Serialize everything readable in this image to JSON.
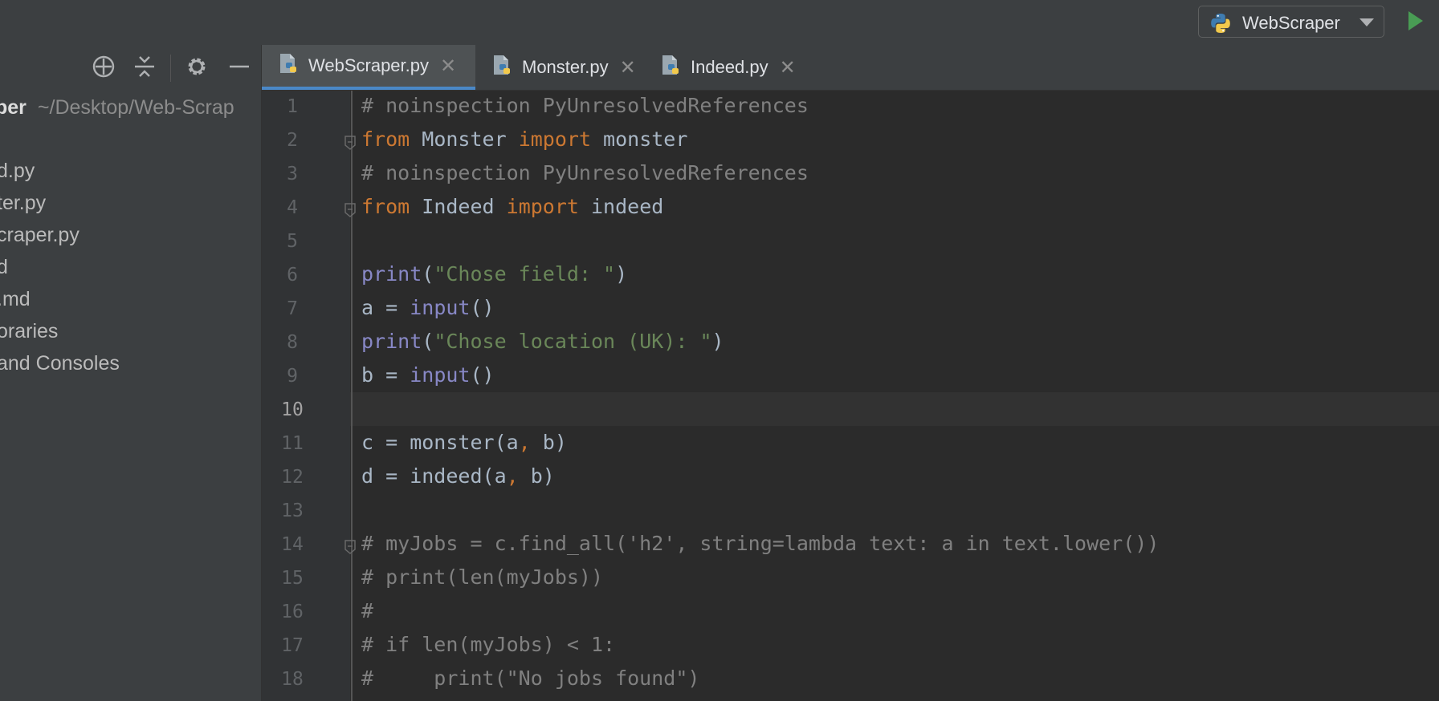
{
  "toolbar": {
    "run_config_label": "WebScraper",
    "icons": [
      "python-icon",
      "dropdown-arrow-icon",
      "run-icon"
    ],
    "run_color": "#499c54"
  },
  "sidebar": {
    "toolbar_icons": [
      "locate-icon",
      "collapse-all-icon",
      "gear-icon",
      "hide-icon"
    ],
    "root_name": "per",
    "root_path": "~/Desktop/Web-Scrap",
    "items": [
      {
        "label": "d.py"
      },
      {
        "label": "ter.py"
      },
      {
        "label": "craper.py"
      },
      {
        "label": "d"
      },
      {
        "label": ".md"
      },
      {
        "label": "oraries"
      },
      {
        "label": "and Consoles"
      }
    ]
  },
  "tabs": [
    {
      "label": "WebScraper.py",
      "active": true
    },
    {
      "label": "Monster.py",
      "active": false
    },
    {
      "label": "Indeed.py",
      "active": false
    }
  ],
  "editor": {
    "current_line": 10,
    "lines": [
      {
        "n": "1",
        "tokens": [
          {
            "t": "# noinspection PyUnresolvedReferences",
            "c": "cm"
          }
        ]
      },
      {
        "n": "2",
        "tokens": [
          {
            "t": "from",
            "c": "kw"
          },
          {
            "t": " Monster ",
            "c": "id"
          },
          {
            "t": "import",
            "c": "kw"
          },
          {
            "t": " monster",
            "c": "id"
          }
        ]
      },
      {
        "n": "3",
        "tokens": [
          {
            "t": "# noinspection PyUnresolvedReferences",
            "c": "cm"
          }
        ]
      },
      {
        "n": "4",
        "tokens": [
          {
            "t": "from",
            "c": "kw"
          },
          {
            "t": " Indeed ",
            "c": "id"
          },
          {
            "t": "import",
            "c": "kw"
          },
          {
            "t": " indeed",
            "c": "id"
          }
        ]
      },
      {
        "n": "5",
        "tokens": []
      },
      {
        "n": "6",
        "tokens": [
          {
            "t": "print",
            "c": "bi"
          },
          {
            "t": "(",
            "c": "id"
          },
          {
            "t": "\"Chose field: \"",
            "c": "st"
          },
          {
            "t": ")",
            "c": "id"
          }
        ]
      },
      {
        "n": "7",
        "tokens": [
          {
            "t": "a = ",
            "c": "id"
          },
          {
            "t": "input",
            "c": "bi"
          },
          {
            "t": "()",
            "c": "id"
          }
        ]
      },
      {
        "n": "8",
        "tokens": [
          {
            "t": "print",
            "c": "bi"
          },
          {
            "t": "(",
            "c": "id"
          },
          {
            "t": "\"Chose location (UK): \"",
            "c": "st"
          },
          {
            "t": ")",
            "c": "id"
          }
        ]
      },
      {
        "n": "9",
        "tokens": [
          {
            "t": "b = ",
            "c": "id"
          },
          {
            "t": "input",
            "c": "bi"
          },
          {
            "t": "()",
            "c": "id"
          }
        ]
      },
      {
        "n": "10",
        "tokens": []
      },
      {
        "n": "11",
        "tokens": [
          {
            "t": "c = monster(a",
            "c": "id"
          },
          {
            "t": ",",
            "c": "kw"
          },
          {
            "t": " b)",
            "c": "id"
          }
        ]
      },
      {
        "n": "12",
        "tokens": [
          {
            "t": "d = indeed(a",
            "c": "id"
          },
          {
            "t": ",",
            "c": "kw"
          },
          {
            "t": " b)",
            "c": "id"
          }
        ]
      },
      {
        "n": "13",
        "tokens": []
      },
      {
        "n": "14",
        "tokens": [
          {
            "t": "# myJobs = c.find_all('h2', string=lambda text: a in text.lower())",
            "c": "cm"
          }
        ]
      },
      {
        "n": "15",
        "tokens": [
          {
            "t": "# print(len(myJobs))",
            "c": "cm"
          }
        ]
      },
      {
        "n": "16",
        "tokens": [
          {
            "t": "#",
            "c": "cm"
          }
        ]
      },
      {
        "n": "17",
        "tokens": [
          {
            "t": "# if len(myJobs) < 1:",
            "c": "cm"
          }
        ]
      },
      {
        "n": "18",
        "tokens": [
          {
            "t": "#     print(\"No jobs found\")",
            "c": "cm"
          }
        ]
      }
    ]
  }
}
